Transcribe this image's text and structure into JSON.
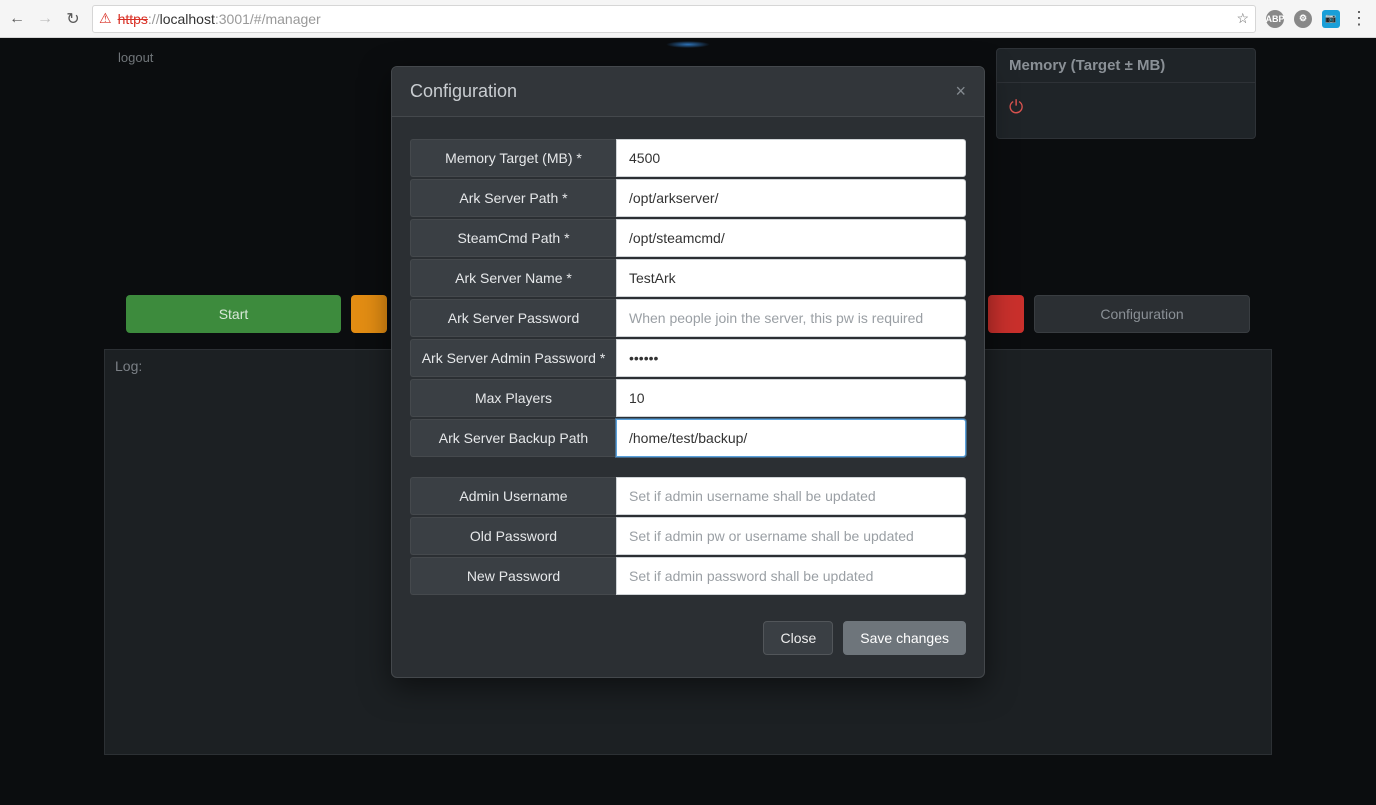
{
  "browser": {
    "url_scheme": "https",
    "url_sep": "://",
    "url_host": "localhost",
    "url_rest": ":3001/#/manager"
  },
  "app": {
    "logout": "logout",
    "memory_panel_title": "Memory (Target ± MB)",
    "buttons": {
      "start": "Start",
      "configuration": "Configuration"
    },
    "log_label": "Log:"
  },
  "modal": {
    "title": "Configuration",
    "close_btn": "Close",
    "save_btn": "Save changes",
    "fields": {
      "memory_target": {
        "label": "Memory Target (MB) *",
        "value": "4500"
      },
      "ark_server_path": {
        "label": "Ark Server Path *",
        "value": "/opt/arkserver/"
      },
      "steamcmd_path": {
        "label": "SteamCmd Path *",
        "value": "/opt/steamcmd/"
      },
      "ark_server_name": {
        "label": "Ark Server Name *",
        "value": "TestArk"
      },
      "ark_server_password": {
        "label": "Ark Server Password",
        "value": "",
        "placeholder": "When people join the server, this pw is required"
      },
      "ark_server_admin_password": {
        "label": "Ark Server Admin Password *",
        "value": "••••••"
      },
      "max_players": {
        "label": "Max Players",
        "value": "10"
      },
      "ark_server_backup_path": {
        "label": "Ark Server Backup Path",
        "value": "/home/test/backup/"
      },
      "admin_username": {
        "label": "Admin Username",
        "value": "",
        "placeholder": "Set if admin username shall be updated"
      },
      "old_password": {
        "label": "Old Password",
        "value": "",
        "placeholder": "Set if admin pw or username shall be updated"
      },
      "new_password": {
        "label": "New Password",
        "value": "",
        "placeholder": "Set if admin password shall be updated"
      }
    }
  }
}
